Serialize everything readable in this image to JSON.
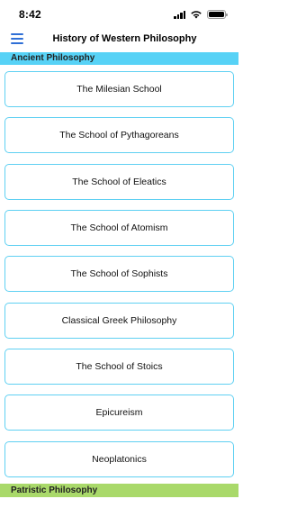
{
  "status_bar": {
    "time": "8:42"
  },
  "nav": {
    "title": "History of Western Philosophy",
    "menu_icon": "hamburger-menu-icon",
    "accent_color": "#2f6fd6"
  },
  "sections": {
    "ancient": {
      "label": "Ancient Philosophy",
      "color": "#57d2f6"
    },
    "patristic": {
      "label": "Patristic Philosophy",
      "color": "#a9d96a"
    }
  },
  "ancient_items": [
    "The Milesian School",
    "The School of Pythagoreans",
    "The School of Eleatics",
    "The School of Atomism",
    "The School of Sophists",
    "Classical Greek Philosophy",
    "The School of Stoics",
    "Epicureism",
    "Neoplatonics"
  ]
}
